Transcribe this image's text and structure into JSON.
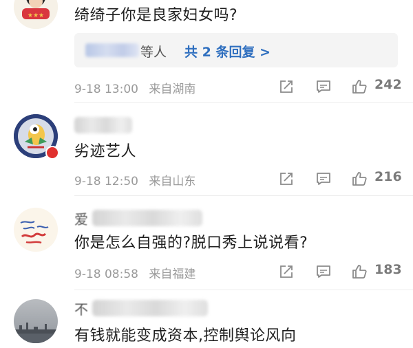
{
  "comments": [
    {
      "text": "绮绮子你是良家妇女吗?",
      "reply_tail": "等人",
      "reply_more": "共 2 条回复 >",
      "date": "9-18 13:00",
      "location": "来自湖南",
      "likes": "242"
    },
    {
      "text": "劣迹艺人",
      "date": "9-18 12:50",
      "location": "来自山东",
      "likes": "216"
    },
    {
      "username_first_char": "爱",
      "text": "你是怎么自强的?脱口秀上说说看?",
      "date": "9-18 08:58",
      "location": "来自福建",
      "likes": "183"
    },
    {
      "username_first_char": "不",
      "text": "有钱就能变成资本,控制舆论风向"
    }
  ],
  "icons": {
    "share": "share-icon",
    "comment": "comment-icon",
    "like": "thumbs-up-icon"
  },
  "colors": {
    "link_blue": "#2f6fbf",
    "meta_gray": "#9a9a9a",
    "reply_bg": "#f4f4f4"
  }
}
